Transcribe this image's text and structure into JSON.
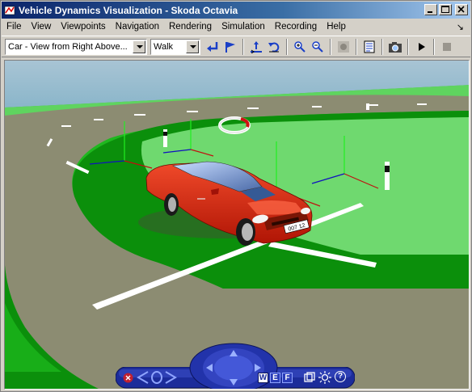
{
  "window": {
    "title": "Vehicle Dynamics Visualization - Skoda Octavia"
  },
  "menu": {
    "items": [
      "File",
      "View",
      "Viewpoints",
      "Navigation",
      "Rendering",
      "Simulation",
      "Recording",
      "Help"
    ]
  },
  "toolbar": {
    "viewpoint_select": "Car - View from Right Above...",
    "navigation_select": "Walk"
  },
  "scene": {
    "license_plate": "007 12"
  },
  "navpanel": {
    "w_label": "W",
    "e_label": "E",
    "f_label": "F",
    "help_label": "?"
  },
  "colors": {
    "title_start": "#0a246a",
    "sky": "#8fb6cc",
    "grass": "#1fb81f",
    "road": "#8c8c72",
    "car": "#d9200f",
    "nav": "#2233aa"
  }
}
